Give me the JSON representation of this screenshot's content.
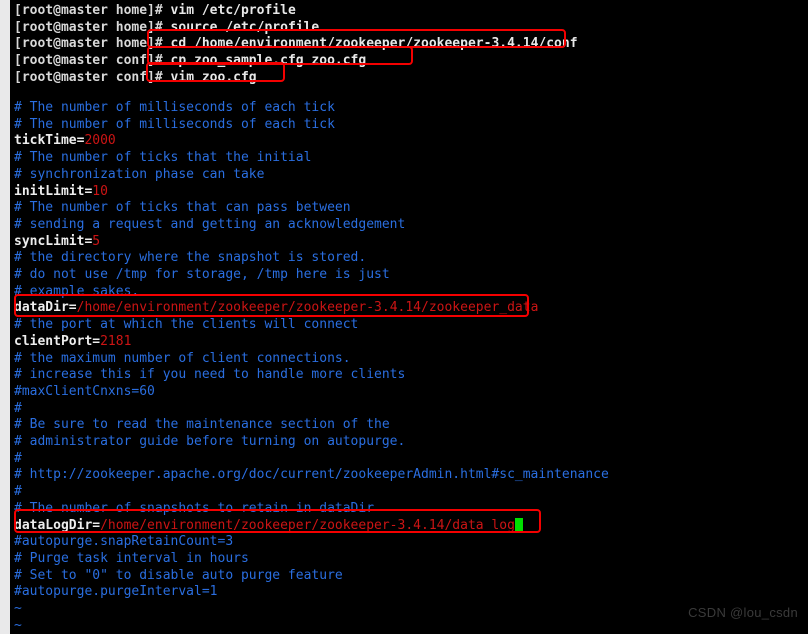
{
  "terminal": {
    "background_color": "#000000",
    "gutter_color": "#e9e9ea",
    "comment_color": "#2a6ee0",
    "value_color": "#cc1414",
    "key_color": "#ededed",
    "highlight_color": "#f40000",
    "cursor_color": "#00e000",
    "prompt_home": "[root@master home]#",
    "prompt_conf": "[root@master conf]#",
    "commands": [
      {
        "prompt": "[root@master home]#",
        "text": " vim /etc/profile"
      },
      {
        "prompt": "[root@master home]#",
        "text": " source /etc/profile"
      },
      {
        "prompt": "[root@master home]#",
        "text": " cd /home/environment/zookeeper/zookeeper-3.4.14/conf"
      },
      {
        "prompt": "[root@master conf]#",
        "text": " cp zoo_sample.cfg zoo.cfg"
      },
      {
        "prompt": "[root@master conf]#",
        "text": " vim zoo.cfg"
      }
    ],
    "config_lines": [
      {
        "type": "comment",
        "text": "# The number of milliseconds of each tick"
      },
      {
        "type": "comment",
        "text": "# The number of milliseconds of each tick"
      },
      {
        "type": "kv",
        "key": "tickTime=",
        "value": "2000"
      },
      {
        "type": "comment",
        "text": "# The number of ticks that the initial"
      },
      {
        "type": "comment",
        "text": "# synchronization phase can take"
      },
      {
        "type": "kv",
        "key": "initLimit=",
        "value": "10"
      },
      {
        "type": "comment",
        "text": "# The number of ticks that can pass between"
      },
      {
        "type": "comment",
        "text": "# sending a request and getting an acknowledgement"
      },
      {
        "type": "kv",
        "key": "syncLimit=",
        "value": "5"
      },
      {
        "type": "comment",
        "text": "# the directory where the snapshot is stored."
      },
      {
        "type": "comment",
        "text": "# do not use /tmp for storage, /tmp here is just"
      },
      {
        "type": "comment",
        "text": "# example sakes."
      },
      {
        "type": "kv",
        "key": "dataDir=",
        "value": "/home/environment/zookeeper/zookeeper-3.4.14/zookeeper_data"
      },
      {
        "type": "comment",
        "text": "# the port at which the clients will connect"
      },
      {
        "type": "kv",
        "key": "clientPort=",
        "value": "2181"
      },
      {
        "type": "comment",
        "text": "# the maximum number of client connections."
      },
      {
        "type": "comment",
        "text": "# increase this if you need to handle more clients"
      },
      {
        "type": "comment",
        "text": "#maxClientCnxns=60"
      },
      {
        "type": "comment",
        "text": "#"
      },
      {
        "type": "comment",
        "text": "# Be sure to read the maintenance section of the"
      },
      {
        "type": "comment",
        "text": "# administrator guide before turning on autopurge."
      },
      {
        "type": "comment",
        "text": "#"
      },
      {
        "type": "comment",
        "text": "# http://zookeeper.apache.org/doc/current/zookeeperAdmin.html#sc_maintenance"
      },
      {
        "type": "comment",
        "text": "#"
      },
      {
        "type": "comment",
        "text": "# The number of snapshots to retain in dataDir"
      },
      {
        "type": "kv",
        "key": "dataLogDir=",
        "value": "/home/environment/zookeeper/zookeeper-3.4.14/data_log",
        "cursor": true
      },
      {
        "type": "comment",
        "text": "#autopurge.snapRetainCount=3"
      },
      {
        "type": "comment",
        "text": "# Purge task interval in hours"
      },
      {
        "type": "comment",
        "text": "# Set to \"0\" to disable auto purge feature"
      },
      {
        "type": "comment",
        "text": "#autopurge.purgeInterval=1"
      },
      {
        "type": "tilde",
        "text": "~"
      },
      {
        "type": "tilde",
        "text": "~"
      }
    ]
  },
  "annotations": {
    "boxes": [
      {
        "name": "cd-command-highlight",
        "label": "# cd /home/environment/zookeeper/zookeeper-3.4.14/conf"
      },
      {
        "name": "cp-command-highlight",
        "label": "# cp zoo_sample.cfg zoo.cfg"
      },
      {
        "name": "vim-command-highlight",
        "label": "# vim zoo.cfg"
      },
      {
        "name": "datadir-highlight",
        "label": "dataDir=/home/environment/zookeeper/zookeeper-3.4.14/zookeeper_data"
      },
      {
        "name": "datalogdir-highlight",
        "label": "dataLogDir=/home/environment/zookeeper/zookeeper-3.4.14/data_log"
      }
    ]
  },
  "watermark": {
    "text": "CSDN @lou_csdn"
  }
}
